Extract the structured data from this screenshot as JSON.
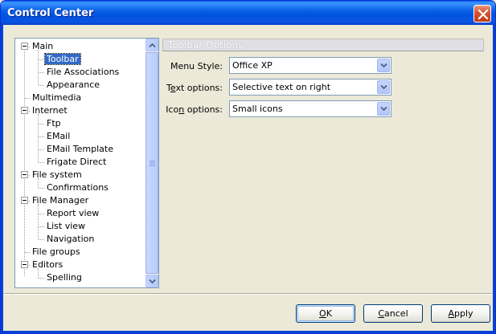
{
  "window": {
    "title": "Control Center"
  },
  "tree": {
    "items": [
      {
        "label": "Main",
        "expanded": true,
        "level": 0
      },
      {
        "label": "Toolbar",
        "level": 1,
        "selected": true
      },
      {
        "label": "File Associations",
        "level": 1
      },
      {
        "label": "Appearance",
        "level": 1
      },
      {
        "label": "Multimedia",
        "level": 0
      },
      {
        "label": "Internet",
        "expanded": true,
        "level": 0
      },
      {
        "label": "Ftp",
        "level": 1
      },
      {
        "label": "EMail",
        "level": 1
      },
      {
        "label": "EMail Template",
        "level": 1
      },
      {
        "label": "Frigate Direct",
        "level": 1
      },
      {
        "label": "File system",
        "expanded": true,
        "level": 0
      },
      {
        "label": "Confirmations",
        "level": 1
      },
      {
        "label": "File Manager",
        "expanded": true,
        "level": 0
      },
      {
        "label": "Report view",
        "level": 1
      },
      {
        "label": "List view",
        "level": 1
      },
      {
        "label": "Navigation",
        "level": 1
      },
      {
        "label": "File groups",
        "level": 0
      },
      {
        "label": "Editors",
        "expanded": true,
        "level": 0
      },
      {
        "label": "Spelling",
        "level": 1
      }
    ]
  },
  "options": {
    "header": "Toolbar Options",
    "menu_style": {
      "label_pre": "Menu Style:",
      "value": "Office XP"
    },
    "text_options": {
      "label_pre": "T",
      "label_ul": "e",
      "label_post": "xt options:",
      "value": "Selective text on right"
    },
    "icon_options": {
      "label_pre": "Ico",
      "label_ul": "n",
      "label_post": " options:",
      "value": "Small icons"
    }
  },
  "buttons": {
    "ok": {
      "ul": "O",
      "rest": "K"
    },
    "cancel": {
      "pre": "",
      "ul": "C",
      "rest": "ancel"
    },
    "apply": {
      "ul": "A",
      "rest": "pply"
    }
  },
  "colors": {
    "selection": "#316AC5",
    "titlebar": "#0052DF",
    "dialog_bg": "#ECE9D8"
  }
}
